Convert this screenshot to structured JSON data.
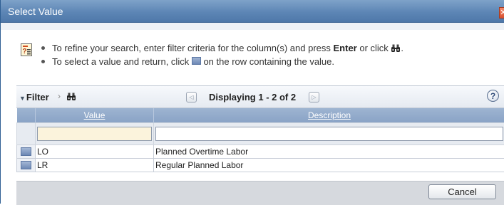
{
  "dialog": {
    "title": "Select Value",
    "close_symbol": "✕"
  },
  "instructions": {
    "icon": "instructions-icon",
    "line1": {
      "prefix": "To refine your search, enter filter criteria for the column(s) and press ",
      "key": "Enter",
      "middle": " or click ",
      "suffix": "."
    },
    "line2": {
      "prefix": "To select a value and return, click ",
      "suffix": " on the row containing the value."
    }
  },
  "filterbar": {
    "label": "Filter",
    "separator": "›",
    "prev_symbol": "◁",
    "next_symbol": "▷",
    "displaying": "Displaying 1 - 2 of 2",
    "help_symbol": "?"
  },
  "table": {
    "columns": [
      "Value",
      "Description"
    ],
    "filters": {
      "value": "",
      "description": ""
    },
    "rows": [
      {
        "value": "LO",
        "description": "Planned Overtime Labor"
      },
      {
        "value": "LR",
        "description": "Regular Planned Labor"
      }
    ]
  },
  "footer": {
    "cancel_label": "Cancel"
  },
  "colors": {
    "titlebar": "#5d86b5",
    "header": "#8aa3c6",
    "filter_value_bg": "#fbf3dc",
    "footer": "#d6d9de"
  }
}
